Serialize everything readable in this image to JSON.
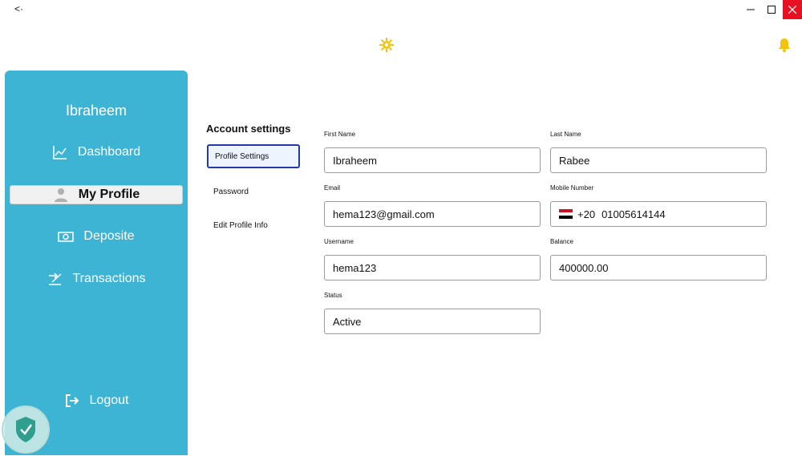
{
  "window": {
    "app_glyph": "<·"
  },
  "sidebar": {
    "user_name": "Ibraheem",
    "items": [
      {
        "label": "Dashboard",
        "icon": "chart-line-icon"
      },
      {
        "label": "My Profile",
        "icon": "person-icon"
      },
      {
        "label": "Deposite",
        "icon": "money-icon"
      },
      {
        "label": "Transactions",
        "icon": "transfer-icon"
      }
    ],
    "logout": {
      "label": "Logout",
      "icon": "logout-icon"
    },
    "color": "#3db4d3"
  },
  "settings_menu": {
    "heading": "Account settings",
    "items": [
      "Profile Settings",
      "Password",
      "Edit Profile Info"
    ]
  },
  "form": {
    "first_name": {
      "label": "First Name",
      "value": "Ibraheem"
    },
    "last_name": {
      "label": "Last Name",
      "value": "Rabee"
    },
    "email": {
      "label": "Email",
      "value": "hema123@gmail.com"
    },
    "mobile": {
      "label": "Mobile Number",
      "code": "+20",
      "value": "01005614144",
      "flag": "egypt-flag-icon"
    },
    "username": {
      "label": "Username",
      "value": "hema123"
    },
    "balance": {
      "label": "Balance",
      "value": "400000.00"
    },
    "status": {
      "label": "Status",
      "value": "Active"
    }
  },
  "colors": {
    "accent_active_border": "#2438a8",
    "close_button": "#e81123",
    "icon_yellow": "#f2c40f"
  }
}
